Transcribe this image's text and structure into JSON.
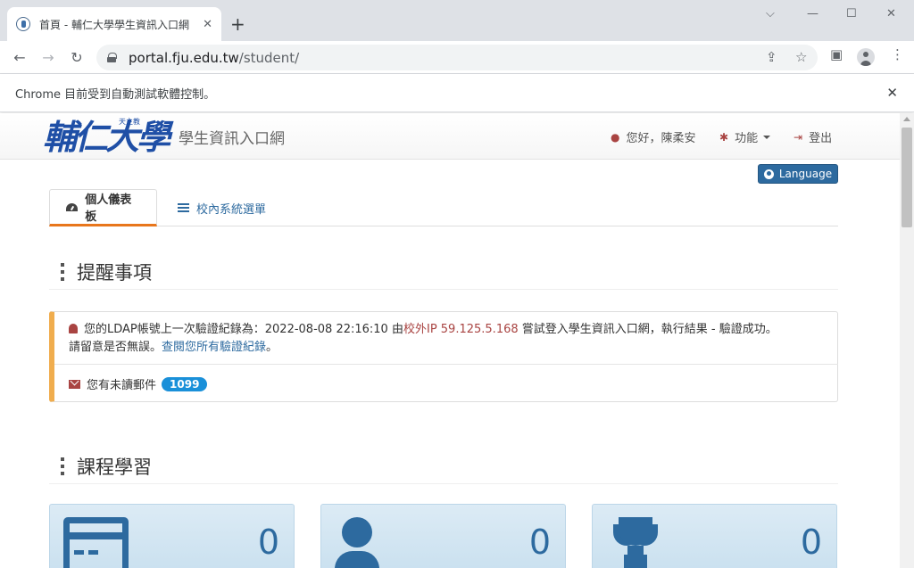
{
  "browser": {
    "tab_title": "首頁 - 輔仁大學學生資訊入口網",
    "url_host": "portal.fju.edu.tw",
    "url_path": "/student/",
    "infobar_text": "Chrome 目前受到自動測試軟體控制。"
  },
  "header": {
    "logo_text": "輔仁大學",
    "logo_small": "天主教",
    "site_title": "學生資訊入口網",
    "greeting": "您好，陳柔安",
    "functions_label": "功能",
    "logout_label": "登出",
    "language_label": "Language"
  },
  "tabs": [
    {
      "label": "個人儀表板",
      "active": true
    },
    {
      "label": "校內系統選單",
      "active": false
    }
  ],
  "reminders": {
    "title": "提醒事項",
    "login_notice": {
      "prefix": "您的LDAP帳號上一次驗證紀錄為：2022-08-08 22:16:10 由",
      "location": "校外",
      "ip": "IP 59.125.5.168",
      "suffix": " 嘗試登入學生資訊入口網，執行結果 - 驗證成功。",
      "line2": "請留意是否無誤。",
      "link": "查閱您所有驗證紀錄",
      "end": "。"
    },
    "mail_notice": {
      "text": "您有未讀郵件",
      "count": "1099"
    }
  },
  "course": {
    "title": "課程學習",
    "cards": [
      {
        "icon": "credit-card-icon",
        "value": "0"
      },
      {
        "icon": "user-icon",
        "value": "0"
      },
      {
        "icon": "trophy-icon",
        "value": "0"
      }
    ]
  },
  "colors": {
    "brand_blue": "#2d6a9f",
    "accent_orange": "#e8761c",
    "warning": "#f0ad4e",
    "danger": "#a94442",
    "badge": "#1a90d9"
  }
}
